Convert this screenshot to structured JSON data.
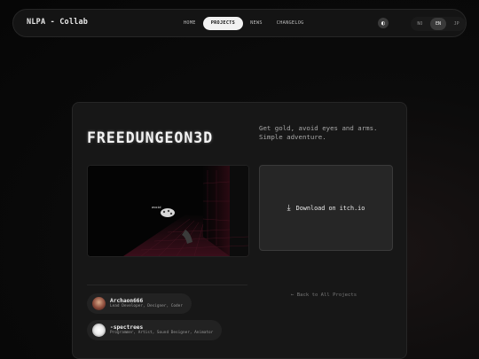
{
  "nav": {
    "brand": "NLPA - Collab",
    "links": [
      "HOME",
      "PROJECTS",
      "NEWS",
      "CHANGELOG"
    ],
    "active_link": "PROJECTS",
    "theme_icon": "half-moon-icon",
    "languages": [
      "NO",
      "EN",
      "JP"
    ],
    "active_language": "EN"
  },
  "project": {
    "title": "FREEDUNGEON3D",
    "tagline": "Get gold, avoid eyes and arms. Simple adventure.",
    "screenshot_caption": "avoid",
    "download_icon": "download-icon",
    "download_label": "Download on itch.io",
    "back_link": "← Back to All Projects"
  },
  "team": [
    {
      "name": "Archaon666",
      "role": "Lead Developer, Designer, Coder"
    },
    {
      "name": "-spectrees",
      "role": "Programmer, Artist, Sound Designer, Animator"
    }
  ]
}
